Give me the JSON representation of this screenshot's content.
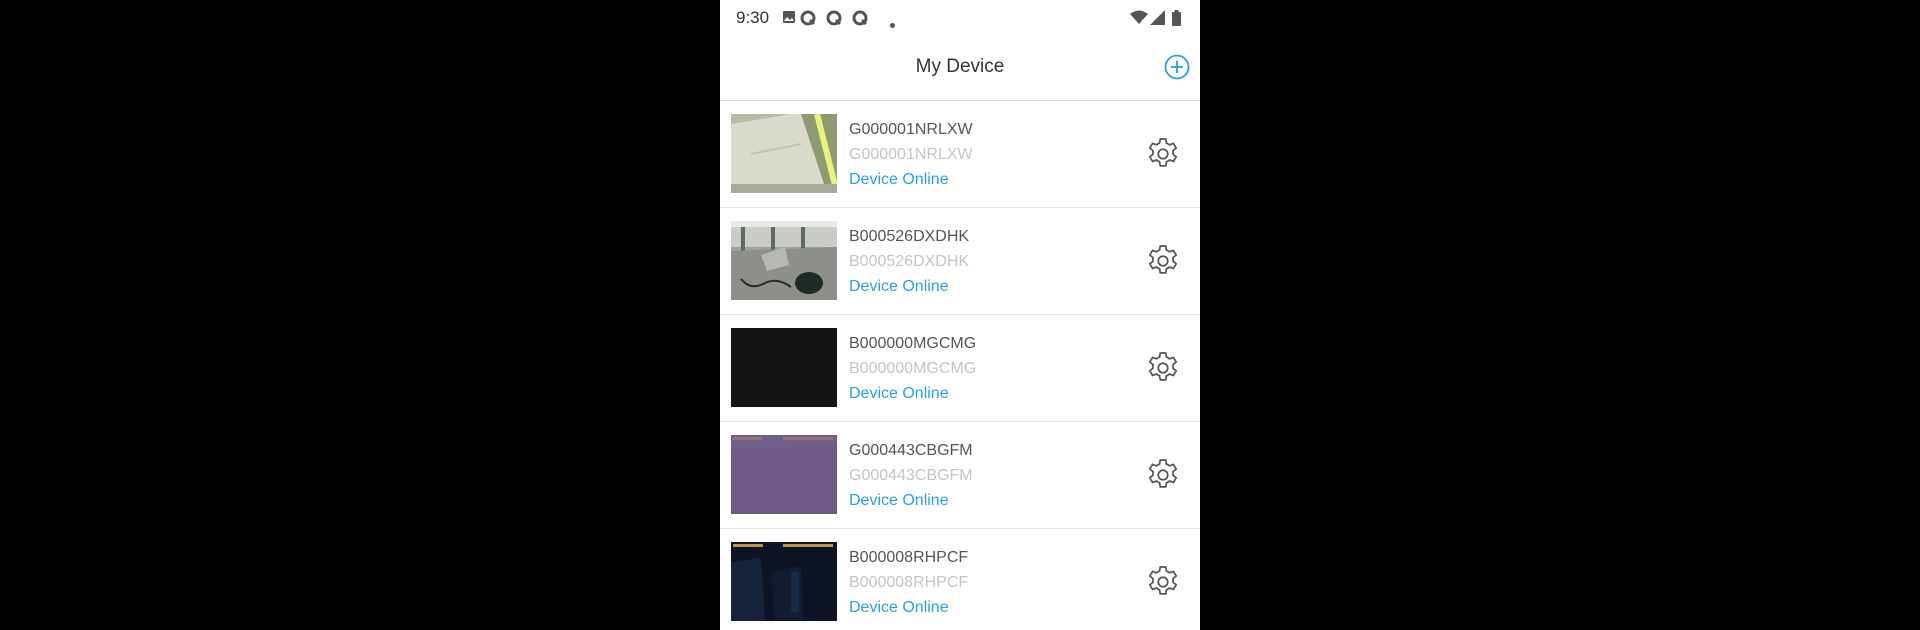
{
  "status_bar": {
    "time": "9:30",
    "left_icons": [
      "image-icon",
      "q-app-icon",
      "q-app-icon",
      "q-app-icon",
      "dot-icon"
    ],
    "right_icons": [
      "wifi-icon",
      "signal-icon",
      "battery-icon"
    ]
  },
  "header": {
    "title": "My Device",
    "add_icon": "plus-circle-icon",
    "accent_color": "#2a9fe0"
  },
  "devices": [
    {
      "name": "G000001NRLXW",
      "id": "G000001NRLXW",
      "status": "Device Online",
      "settings_icon": "gear-icon"
    },
    {
      "name": "B000526DXDHK",
      "id": "B000526DXDHK",
      "status": "Device Online",
      "settings_icon": "gear-icon"
    },
    {
      "name": "B000000MGCMG",
      "id": "B000000MGCMG",
      "status": "Device Online",
      "settings_icon": "gear-icon"
    },
    {
      "name": "G000443CBGFM",
      "id": "G000443CBGFM",
      "status": "Device Online",
      "settings_icon": "gear-icon"
    },
    {
      "name": "B000008RHPCF",
      "id": "B000008RHPCF",
      "status": "Device Online",
      "settings_icon": "gear-icon"
    }
  ],
  "colors": {
    "status_online": "#2a9fe0",
    "name_text": "#555555",
    "id_text": "#c4c4c4"
  }
}
